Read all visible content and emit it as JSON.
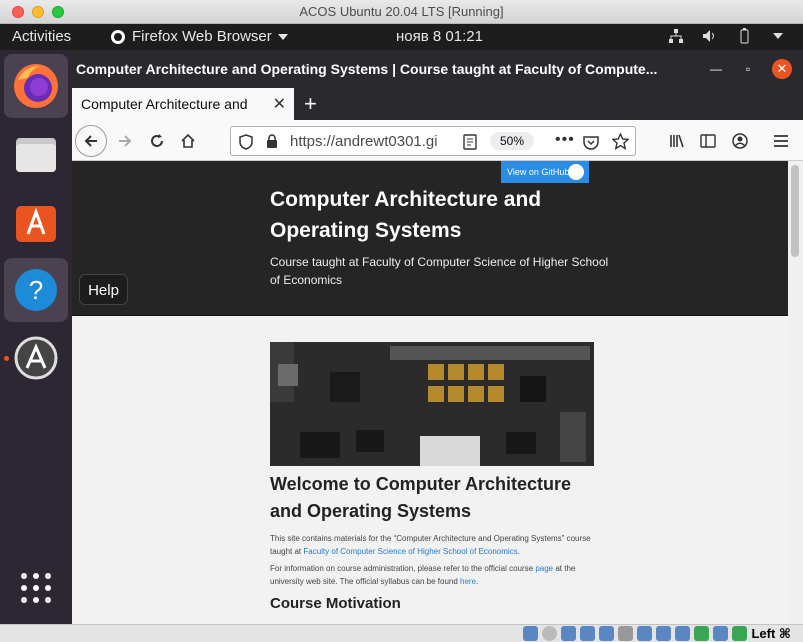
{
  "host_window": {
    "title": "ACOS Ubuntu 20.04 LTS [Running]",
    "host_key": "Left ⌘"
  },
  "topbar": {
    "activities": "Activities",
    "app_name": "Firefox Web Browser",
    "clock": "нояв 8  01:21"
  },
  "dock": {
    "items": [
      {
        "name": "firefox",
        "icon": "firefox-icon"
      },
      {
        "name": "files",
        "icon": "files-icon"
      },
      {
        "name": "software",
        "icon": "software-icon"
      },
      {
        "name": "help",
        "icon": "help-icon"
      },
      {
        "name": "updater",
        "icon": "updater-icon"
      }
    ],
    "tooltip": "Help"
  },
  "browser": {
    "window_title": "Computer Architecture and Operating Systems | Course taught at Faculty of Compute...",
    "tab_label": "Computer Architecture and",
    "url": "https://andrewt0301.gi",
    "zoom": "50%"
  },
  "page": {
    "github_badge": "View on GitHub",
    "header_title": "Computer Architecture and Operating Systems",
    "header_tagline": "Course taught at Faculty of Computer Science of Higher School of Economics",
    "welcome_heading": "Welcome to Computer Architecture and Operating Systems",
    "para1_a": "This site contains materials for the “Computer Architecture and Operating Systems” course taught at ",
    "para1_link": "Faculty of Computer Science of Higher School of Economics",
    "para1_b": ".",
    "para2_a": "For information on course administration, please refer to the official course ",
    "para2_link1": "page",
    "para2_b": " at the university web site. The official syllabus can be found ",
    "para2_link2": "here",
    "para2_c": ".",
    "motivation_heading": "Course Motivation"
  },
  "colors": {
    "ubuntu_orange": "#e95420",
    "dock_bg": "#2d2733",
    "link": "#2879d0",
    "github_blue": "#2b8ce6"
  }
}
